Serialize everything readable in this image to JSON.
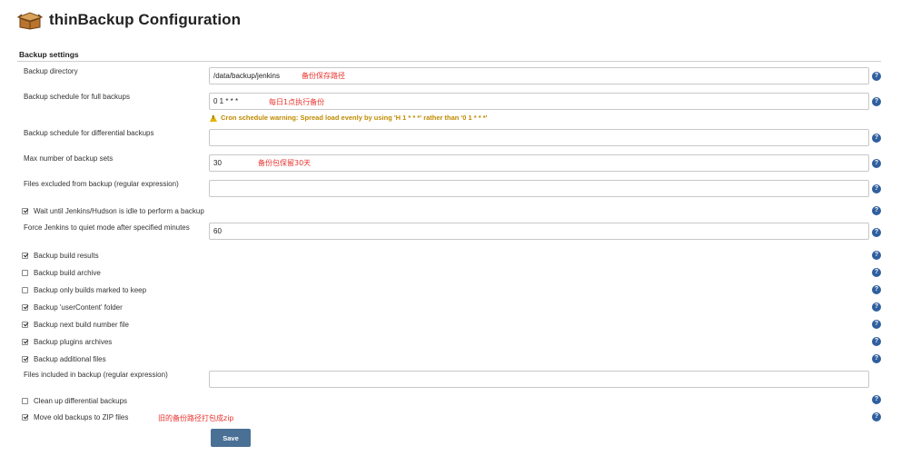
{
  "page": {
    "title": "thinBackup Configuration",
    "logo_icon": "thinbackup-box-icon"
  },
  "section": {
    "title": "Backup settings"
  },
  "fields": {
    "backup_directory": {
      "label": "Backup directory",
      "value": "/data/backup/jenkins",
      "annotation": "备份保存路径"
    },
    "full_schedule": {
      "label": "Backup schedule for full backups",
      "value": "0 1 * * *",
      "annotation": "每日1点执行备份",
      "warning": "Cron schedule warning: Spread load evenly by using 'H 1 * * *' rather than '0 1 * * *'"
    },
    "diff_schedule": {
      "label": "Backup schedule for differential backups",
      "value": ""
    },
    "max_sets": {
      "label": "Max number of backup sets",
      "value": "30",
      "annotation": "备份包保留30天"
    },
    "excluded": {
      "label": "Files excluded from backup (regular expression)",
      "value": ""
    },
    "wait_idle": {
      "label": "Wait until Jenkins/Hudson is idle to perform a backup",
      "checked": true
    },
    "quiet_mode": {
      "label": "Force Jenkins to quiet mode after specified minutes",
      "value": "60"
    },
    "included": {
      "label": "Files included in backup (regular expression)",
      "value": ""
    }
  },
  "checkboxes": [
    {
      "label": "Backup build results",
      "checked": true
    },
    {
      "label": "Backup build archive",
      "checked": false
    },
    {
      "label": "Backup only builds marked to keep",
      "checked": false
    },
    {
      "label": "Backup 'userContent' folder",
      "checked": true
    },
    {
      "label": "Backup next build number file",
      "checked": true
    },
    {
      "label": "Backup plugins archives",
      "checked": true
    },
    {
      "label": "Backup additional files",
      "checked": true
    }
  ],
  "bottom_checkboxes": [
    {
      "label": "Clean up differential backups",
      "checked": false
    },
    {
      "label": "Move old backups to ZIP files",
      "checked": true,
      "annotation": "旧的备份路径打包成zip"
    }
  ],
  "help_icon": "?",
  "save_label": "Save",
  "colors": {
    "annotation": "#e8322d",
    "warning": "#c08a00",
    "help": "#2f5f9e",
    "save": "#4a7096"
  }
}
